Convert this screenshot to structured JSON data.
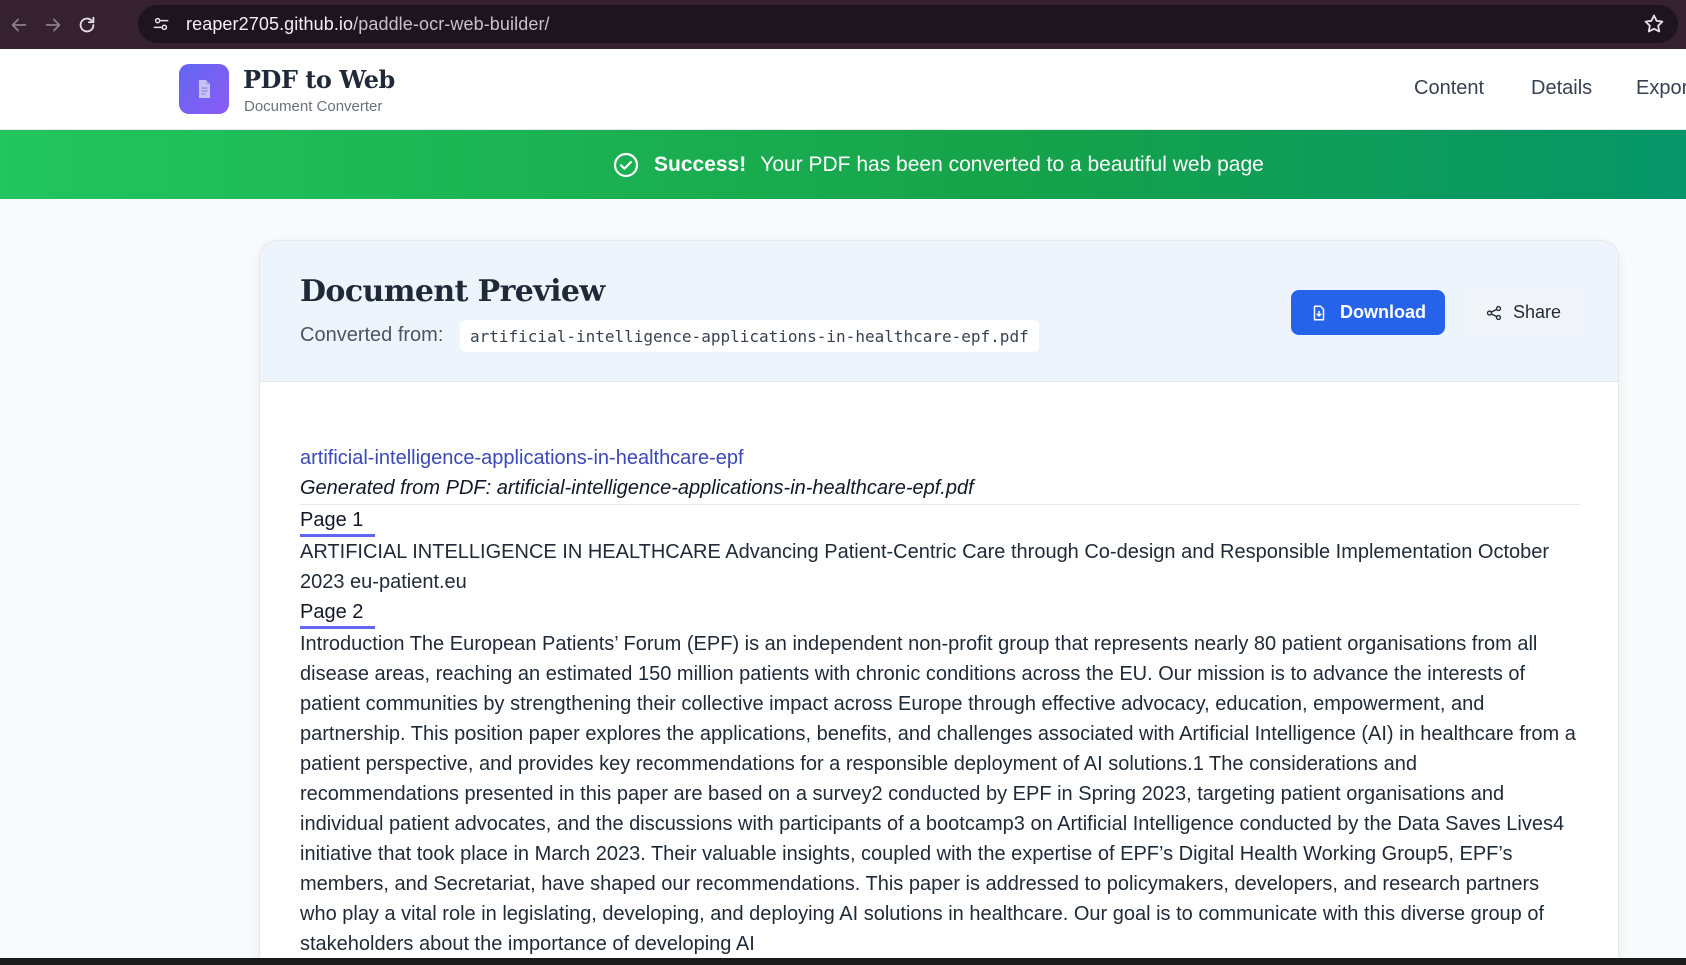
{
  "browser": {
    "url_host": "reaper2705.github.io",
    "url_path": "/paddle-ocr-web-builder/"
  },
  "header": {
    "brand_title": "PDF to Web",
    "brand_subtitle": "Document Converter",
    "nav": {
      "content": "Content",
      "details": "Details",
      "export": "Expor"
    }
  },
  "banner": {
    "strong": "Success!",
    "message": "Your PDF has been converted to a beautiful web page"
  },
  "preview": {
    "title": "Document Preview",
    "converted_label": "Converted from:",
    "filename": "artificial-intelligence-applications-in-healthcare-epf.pdf",
    "download_label": "Download",
    "share_label": "Share"
  },
  "document": {
    "link_title": "artificial-intelligence-applications-in-healthcare-epf",
    "generated": "Generated from PDF: artificial-intelligence-applications-in-healthcare-epf.pdf",
    "pages": [
      {
        "heading": "Page 1",
        "text": "ARTIFICIAL INTELLIGENCE IN HEALTHCARE Advancing Patient-Centric Care through Co-design and Responsible Implementation October 2023 eu-patient.eu"
      },
      {
        "heading": "Page 2",
        "text": "Introduction The European Patients’ Forum (EPF) is an independent non-profit group that represents nearly 80 patient organisations from all disease areas, reaching an estimated 150 million patients with chronic conditions across the EU. Our mission is to advance the interests of patient communities by strengthening their collective impact across Europe through effective advocacy, education, empowerment, and partnership. This position paper explores the applications, benefits, and challenges associated with Artificial Intelligence (AI) in healthcare from a patient perspective, and provides key recommendations for a responsible deployment of AI solutions.1 The considerations and recommendations presented in this paper are based on a survey2 conducted by EPF in Spring 2023, targeting patient organisations and individual patient advocates, and the discussions with participants of a bootcamp3 on Artificial Intelligence conducted by the Data Saves Lives4 initiative that took place in March 2023. Their valuable insights, coupled with the expertise of EPF’s Digital Health Working Group5, EPF’s members, and Secretariat, have shaped our recommendations. This paper is addressed to policymakers, developers, and research partners who play a vital role in legislating, developing, and deploying AI solutions in healthcare. Our goal is to communicate with this diverse group of stakeholders about the importance of developing AI"
      }
    ]
  },
  "colors": {
    "banner_start": "#22c55e",
    "banner_end": "#059669",
    "primary_button": "#2563eb",
    "logo_start": "#6366f1",
    "logo_end": "#8b5cf6",
    "link": "#3b48b8"
  },
  "icons": {
    "back": "arrow-left-icon",
    "forward": "arrow-right-icon",
    "reload": "reload-icon",
    "site_info": "tune-icon",
    "bookmark": "star-icon",
    "logo": "document-icon",
    "banner": "check-circle-icon",
    "download": "file-download-icon",
    "share": "share-icon"
  }
}
